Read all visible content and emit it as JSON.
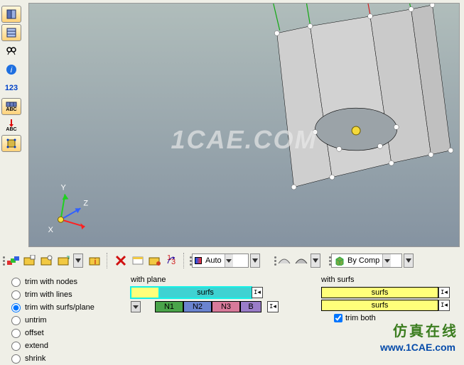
{
  "viewport": {
    "watermark": "1CAE.COM",
    "axes": {
      "x": "X",
      "y": "Y",
      "z": "Z"
    }
  },
  "left_toolbar": {
    "items": [
      "perspective-icon",
      "wireframe-icon",
      "find-icon",
      "info-icon",
      "123-icon",
      "abc-grid-icon",
      "abc-arrow-icon",
      "transform-icon"
    ],
    "info_text": "123",
    "abc_text": "ABC"
  },
  "mid_toolbar": {
    "auto_label": "Auto",
    "bycomp_label": "By Comp"
  },
  "panel": {
    "radios": [
      "trim with nodes",
      "trim with lines",
      "trim with surfs/plane",
      "untrim",
      "offset",
      "extend",
      "shrink"
    ],
    "selected_radio": "trim with surfs/plane",
    "with_plane_label": "with plane",
    "with_surfs_label": "with surfs",
    "surfs_label": "surfs",
    "n1": "N1",
    "n2": "N2",
    "n3": "N3",
    "b": "B",
    "trim_both_label": "trim both",
    "trim_both_checked": true
  },
  "footer": {
    "brand_cn": "仿真在线",
    "url": "www.1CAE.com"
  }
}
